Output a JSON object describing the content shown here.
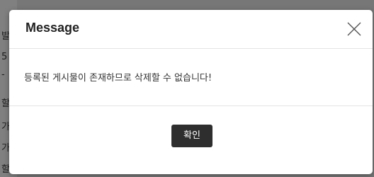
{
  "background_page": {
    "edge_chars": [
      "발",
      "5",
      "-",
      "할",
      "가",
      "가",
      "할"
    ]
  },
  "dialog": {
    "title": "Message",
    "close_icon": "close-icon",
    "message": "등록된 게시물이 존재하므로 삭제할 수 없습니다!",
    "confirm_label": "확인"
  },
  "colors": {
    "dialog_bg": "#ffffff",
    "button_bg": "#2e2e2e",
    "button_text": "#ffffff",
    "overlay": "#777777"
  }
}
